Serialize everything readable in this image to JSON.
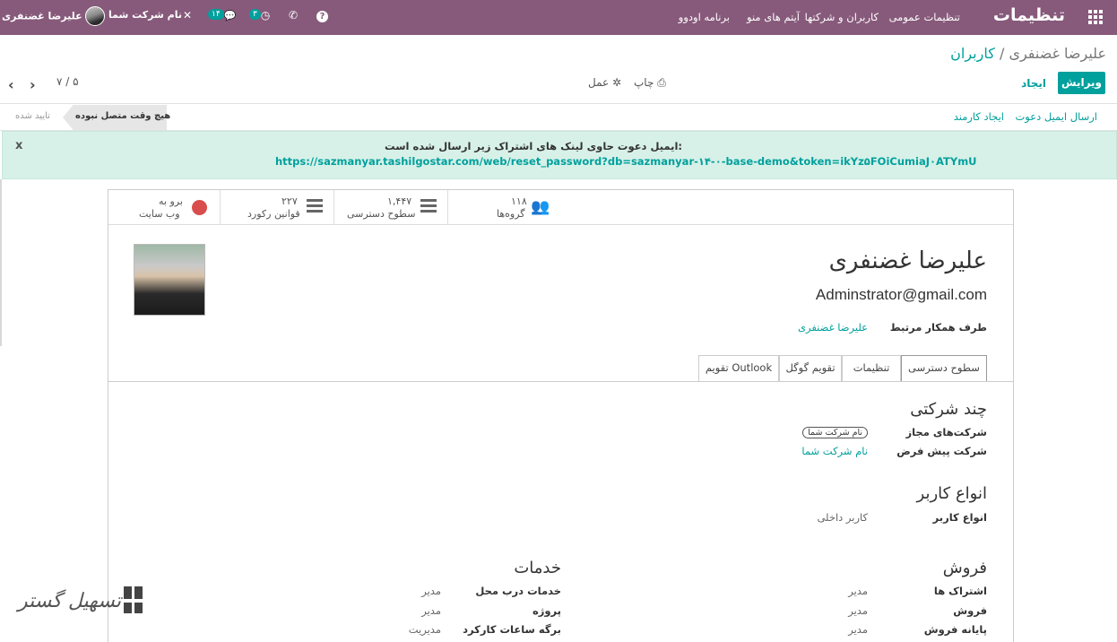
{
  "colors": {
    "brand": "#875a7b",
    "accent": "#00a09d",
    "alert_bg": "#d7f1e8"
  },
  "navbar": {
    "app_title": "تنظیمات",
    "menu": [
      "تنظیمات عمومی",
      "کاربران و شرکتها",
      "آیتم های منو",
      "برنامه اودوو"
    ],
    "company": "نام شرکت شما",
    "activity_count": "۳",
    "message_count": "۱۴",
    "user_name": "علیرضا غضنفری",
    "help": "?"
  },
  "breadcrumb": {
    "parent": "کاربران",
    "separator": "/",
    "current": "علیرضا غضنفری"
  },
  "controls": {
    "edit": "ویرایش",
    "create": "ایجاد",
    "print": "چاپ",
    "action": "عمل",
    "pager": "۷ / ۵"
  },
  "header_actions": {
    "send_invite": "ارسال ایمیل دعوت",
    "create_employee": "ایجاد کارمند"
  },
  "status": {
    "never_connected": "هیچ وقت متصل نبوده",
    "confirmed": "تایید شده"
  },
  "alert": {
    "title": "ایمیل دعوت حاوی لینک های اشتراک زیر ارسال شده است:",
    "url": "https://sazmanyar.tashilgostar.com/web/reset_password?db=sazmanyar-۱۴-۰-base-demo&token=ikYz۵FOiCumiaJ۰ATYmU",
    "close": "x"
  },
  "smart_buttons": [
    {
      "value": "۱۱۸",
      "label": "گروه‌ها",
      "icon": "users-icon"
    },
    {
      "value": "۱,۴۴۷",
      "label": "سطوح دسترسی",
      "icon": "list-icon"
    },
    {
      "value": "۲۲۷",
      "label": "قوانین رکورد",
      "icon": "list-icon"
    },
    {
      "value": "برو به",
      "label": "وب سایت",
      "icon": "globe-icon"
    }
  ],
  "user": {
    "name": "علیرضا غضنفری",
    "email": "Adminstrator@gmail.com",
    "partner_label": "طرف همکار مرتبط",
    "partner_value": "علیرضا غضنفری"
  },
  "tabs": [
    "سطوح دسترسی",
    "تنظیمات",
    "تقویم گوگل",
    "تقویم Outlook"
  ],
  "multi_company": {
    "title": "چند شرکتی",
    "allowed_label": "شرکت‌های مجاز",
    "allowed_tag": "نام شرکت شما",
    "default_label": "شرکت پیش فرض",
    "default_value": "نام شرکت شما"
  },
  "user_types": {
    "title": "انواع کاربر",
    "label": "انواع کاربر",
    "value": "کاربر داخلی"
  },
  "sales": {
    "title": "فروش",
    "rows": [
      {
        "label": "اشتراک ها",
        "value": "مدیر"
      },
      {
        "label": "فروش",
        "value": "مدیر"
      },
      {
        "label": "پایانه فروش",
        "value": "مدیر"
      }
    ]
  },
  "services": {
    "title": "خدمات",
    "rows": [
      {
        "label": "خدمات درب محل",
        "value": "مدیر"
      },
      {
        "label": "پروژه",
        "value": "مدیر"
      },
      {
        "label": "برگه ساعات کارکرد",
        "value": "مدیریت"
      }
    ]
  },
  "watermark": {
    "text": "تسهیل گستر"
  }
}
